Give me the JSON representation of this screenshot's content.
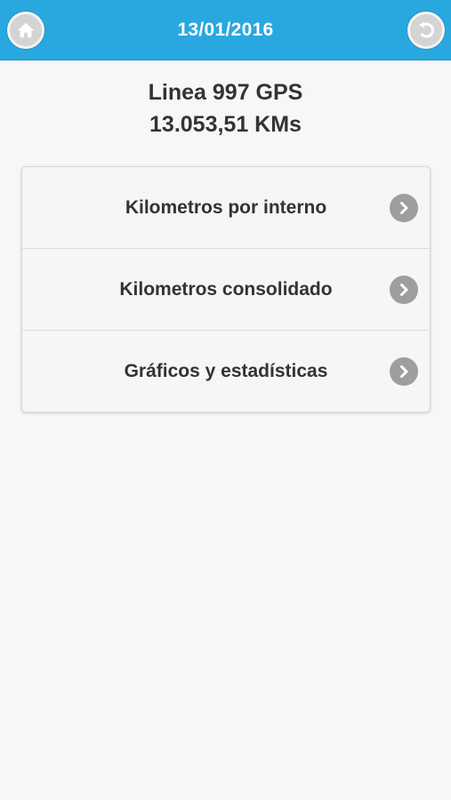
{
  "header": {
    "title": "13/01/2016",
    "home_icon": "home-icon",
    "back_icon": "undo-back-icon",
    "color": "#29a8e0"
  },
  "info": {
    "line_name": "Linea 997 GPS",
    "kilometers": "13.053,51 KMs"
  },
  "menu": {
    "items": [
      {
        "label": "Kilometros por interno",
        "icon": "chevron-right-icon"
      },
      {
        "label": "Kilometros consolidado",
        "icon": "chevron-right-icon"
      },
      {
        "label": "Gráficos y estadísticas",
        "icon": "chevron-right-icon"
      }
    ]
  }
}
